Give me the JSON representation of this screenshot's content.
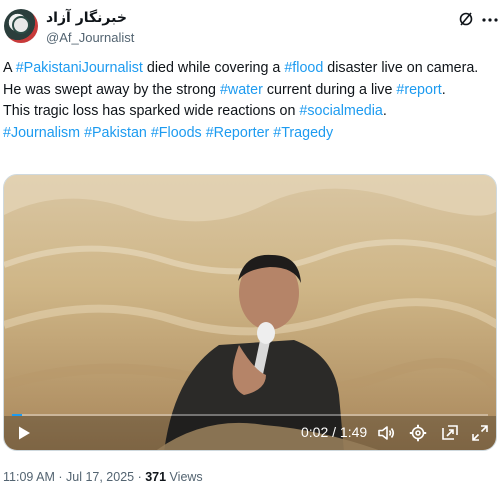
{
  "author": {
    "display_name": "خبرنگار آزاد",
    "handle": "@Af_Journalist"
  },
  "post": {
    "segments": [
      {
        "t": "A ",
        "h": false
      },
      {
        "t": "#PakistaniJournalist",
        "h": true
      },
      {
        "t": " died while covering a ",
        "h": false
      },
      {
        "t": "#flood",
        "h": true
      },
      {
        "t": " disaster live on camera.",
        "h": false
      },
      {
        "t": "\n",
        "h": false
      },
      {
        "t": "He was swept away by the strong ",
        "h": false
      },
      {
        "t": "#water",
        "h": true
      },
      {
        "t": " current during a live ",
        "h": false
      },
      {
        "t": "#report",
        "h": true
      },
      {
        "t": ".",
        "h": false
      },
      {
        "t": "\n",
        "h": false
      },
      {
        "t": "This tragic loss has sparked wide reactions on ",
        "h": false
      },
      {
        "t": "#socialmedia",
        "h": true
      },
      {
        "t": ".",
        "h": false
      },
      {
        "t": "\n",
        "h": false
      },
      {
        "t": "#Journalism",
        "h": true
      },
      {
        "t": " ",
        "h": false
      },
      {
        "t": "#Pakistan",
        "h": true
      },
      {
        "t": " ",
        "h": false
      },
      {
        "t": "#Floods",
        "h": true
      },
      {
        "t": " ",
        "h": false
      },
      {
        "t": "#Reporter",
        "h": true
      },
      {
        "t": " ",
        "h": false
      },
      {
        "t": "#Tragedy",
        "h": true
      }
    ]
  },
  "video": {
    "time": "0:02 / 1:49",
    "progress": 0.02,
    "accent": "#1d9bf0"
  },
  "meta": {
    "time": "11:09 AM",
    "sep1": " · ",
    "date": "Jul 17, 2025",
    "sep2": " · ",
    "views_count": "371",
    "views_label": " Views"
  },
  "icons": {
    "grok": "grok-icon",
    "more": "more-icon",
    "play": "play-icon",
    "volume": "volume-icon",
    "settings": "gear-icon",
    "pip": "picture-in-picture-icon",
    "fullscreen": "fullscreen-icon"
  },
  "colors": {
    "link": "#1d9bf0",
    "muted": "#536471",
    "text": "#0f1419"
  }
}
